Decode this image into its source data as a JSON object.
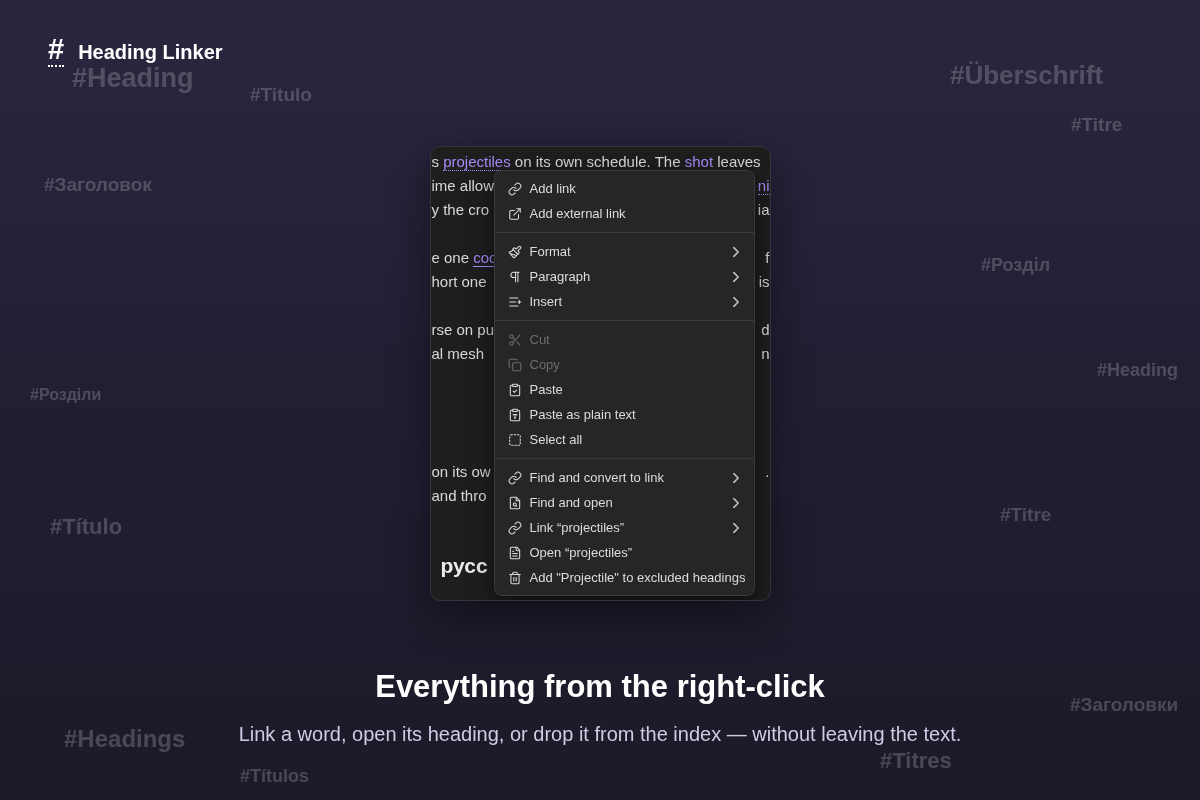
{
  "logo": {
    "mark": "#",
    "name": "Heading Linker"
  },
  "background_words": [
    "#Heading",
    "#Titulo",
    "#Überschrift",
    "#Titre",
    "#Заголовок",
    "#Розділ",
    "#Heading",
    "#Розділи",
    "#Título",
    "#Titre",
    "#Заголовки",
    "#Headings",
    "#Titres",
    "#Títulos"
  ],
  "editor": {
    "paragraphs": [
      {
        "lines": [
          {
            "left": [
              {
                "kind": "text",
                "text": "s "
              },
              {
                "kind": "link-dotted",
                "text": "projectiles"
              },
              {
                "kind": "text",
                "text": " on its own schedule. The "
              },
              {
                "kind": "link",
                "text": "shot"
              },
              {
                "kind": "text",
                "text": " leaves"
              }
            ]
          },
          {
            "left": [
              {
                "kind": "text",
                "text": "ime allow"
              }
            ],
            "right": [
              {
                "kind": "link-dotted",
                "text": "ni"
              }
            ]
          },
          {
            "left": [
              {
                "kind": "text",
                "text": "y the cro"
              }
            ],
            "right": [
              {
                "kind": "text",
                "text": "ia"
              }
            ]
          }
        ]
      },
      {
        "lines": [
          {
            "left": [
              {
                "kind": "text",
                "text": "e one "
              },
              {
                "kind": "link-solid",
                "text": "coc"
              }
            ],
            "right": [
              {
                "kind": "text",
                "text": "f"
              }
            ]
          },
          {
            "left": [
              {
                "kind": "text",
                "text": "hort one"
              }
            ],
            "right": [
              {
                "kind": "text",
                "text": "is"
              }
            ]
          }
        ]
      },
      {
        "lines": [
          {
            "left": [
              {
                "kind": "text",
                "text": "rse on pu"
              }
            ],
            "right": [
              {
                "kind": "text",
                "text": "d"
              }
            ]
          },
          {
            "left": [
              {
                "kind": "text",
                "text": "al mesh"
              }
            ],
            "right": [
              {
                "kind": "text",
                "text": "n"
              }
            ]
          }
        ]
      },
      {
        "lines": [
          {
            "left": [
              {
                "kind": "text",
                "text": "on its ow"
              }
            ],
            "right": [
              {
                "kind": "text",
                "text": "."
              }
            ]
          },
          {
            "left": [
              {
                "kind": "text",
                "text": "and thro"
              }
            ]
          }
        ]
      }
    ],
    "heading": "русс"
  },
  "context_menu": {
    "groups": [
      {
        "items": [
          {
            "label": "Add link",
            "disabled": false,
            "submenu": false
          },
          {
            "label": "Add external link",
            "disabled": false,
            "submenu": false
          }
        ]
      },
      {
        "items": [
          {
            "label": "Format",
            "disabled": false,
            "submenu": true
          },
          {
            "label": "Paragraph",
            "disabled": false,
            "submenu": true
          },
          {
            "label": "Insert",
            "disabled": false,
            "submenu": true
          }
        ]
      },
      {
        "items": [
          {
            "label": "Cut",
            "disabled": true,
            "submenu": false
          },
          {
            "label": "Copy",
            "disabled": true,
            "submenu": false
          },
          {
            "label": "Paste",
            "disabled": false,
            "submenu": false
          },
          {
            "label": "Paste as plain text",
            "disabled": false,
            "submenu": false
          },
          {
            "label": "Select all",
            "disabled": false,
            "submenu": false
          }
        ]
      },
      {
        "items": [
          {
            "label": "Find and convert to link",
            "disabled": false,
            "submenu": true
          },
          {
            "label": "Find and open",
            "disabled": false,
            "submenu": true
          },
          {
            "label": "Link “projectiles”",
            "disabled": false,
            "submenu": true
          },
          {
            "label": "Open “projectiles”",
            "disabled": false,
            "submenu": false
          },
          {
            "label": "Add \"Projectile\" to excluded headings",
            "disabled": false,
            "submenu": false
          }
        ]
      }
    ]
  },
  "hero": {
    "title": "Everything from the right-click",
    "subtitle": "Link a word, open its heading, or drop it from the index — without leaving the text."
  }
}
